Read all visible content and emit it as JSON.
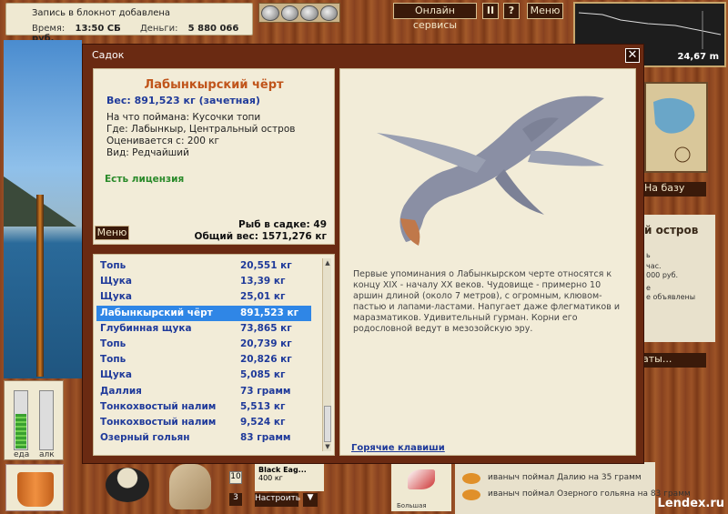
{
  "topbar": {
    "notice": "Запись в блокнот добавлена",
    "time_label": "Время:",
    "time_value": "13:50 СБ",
    "money_label": "Деньги:",
    "money_value": "5 880 066 руб.",
    "online_services": "Онлайн сервисы",
    "pause_label": "II",
    "help_label": "?",
    "menu_label": "Меню",
    "depth_value": "24,67 m"
  },
  "side": {
    "to_base": "На базу",
    "island_title": "й остров",
    "island_lines": [
      "ь",
      "час.",
      "000 руб.",
      "е",
      "е объявлены"
    ],
    "gifts": "аты..."
  },
  "gauges": {
    "food_label": "еда",
    "alcohol_label": "алк",
    "food_level": 0.6,
    "alcohol_level": 0.0
  },
  "bottom": {
    "slot1": "10",
    "slot2": "3",
    "reel_name": "Black Eag...",
    "reel_weight": "400 кг",
    "setup_button": "Настроить",
    "arrow": "▼",
    "lure_name": "Большая",
    "log": [
      "иваныч поймал Далию на 35 грамм",
      "иваныч поймал Озерного гольяна на 83 грамм"
    ],
    "watermark": "Lendex.ru"
  },
  "dialog": {
    "title": "Садок",
    "close": "✕",
    "fish_name": "Лабынкырский чёрт",
    "fish_weight": "Вес: 891,523 кг (зачетная)",
    "caught_on": "На что поймана: Кусочки топи",
    "location": "Где: Лабынкыр, Центральный остров",
    "value": "Оценивается с: 200 кг",
    "kind": "Вид: Редчайший",
    "license": "Есть лицензия",
    "menu_button": "Меню",
    "fish_count": "Рыб в садке: 49",
    "total_weight": "Общий вес: 1571,276 кг",
    "description": "Первые упоминания о Лабынкырском черте относятся к концу XIX - началу XX веков. Чудовище - примерно 10 аршин длиной (около 7 метров), с огромным, клювом-пастью и лапами-ластами. Напугает даже флегматиков и маразматиков. Удивительный гурман. Корни его родословной ведут в мезозойскую эру.",
    "hotkeys": "Горячие клавиши",
    "fish_list": [
      {
        "name": "Топь",
        "weight": "20,551 кг"
      },
      {
        "name": "Щука",
        "weight": "13,39 кг"
      },
      {
        "name": "Щука",
        "weight": "25,01 кг"
      },
      {
        "name": "Лабынкырский чёрт",
        "weight": "891,523 кг"
      },
      {
        "name": "Глубинная щука",
        "weight": "73,865 кг"
      },
      {
        "name": "Топь",
        "weight": "20,739 кг"
      },
      {
        "name": "Топь",
        "weight": "20,826 кг"
      },
      {
        "name": "Щука",
        "weight": "5,085 кг"
      },
      {
        "name": "Даллия",
        "weight": "73 грамм"
      },
      {
        "name": "Тонкохвостый налим",
        "weight": "5,513 кг"
      },
      {
        "name": "Тонкохвостый налим",
        "weight": "9,524 кг"
      },
      {
        "name": "Озерный гольян",
        "weight": "83 грамм"
      }
    ],
    "selected_index": 3
  }
}
